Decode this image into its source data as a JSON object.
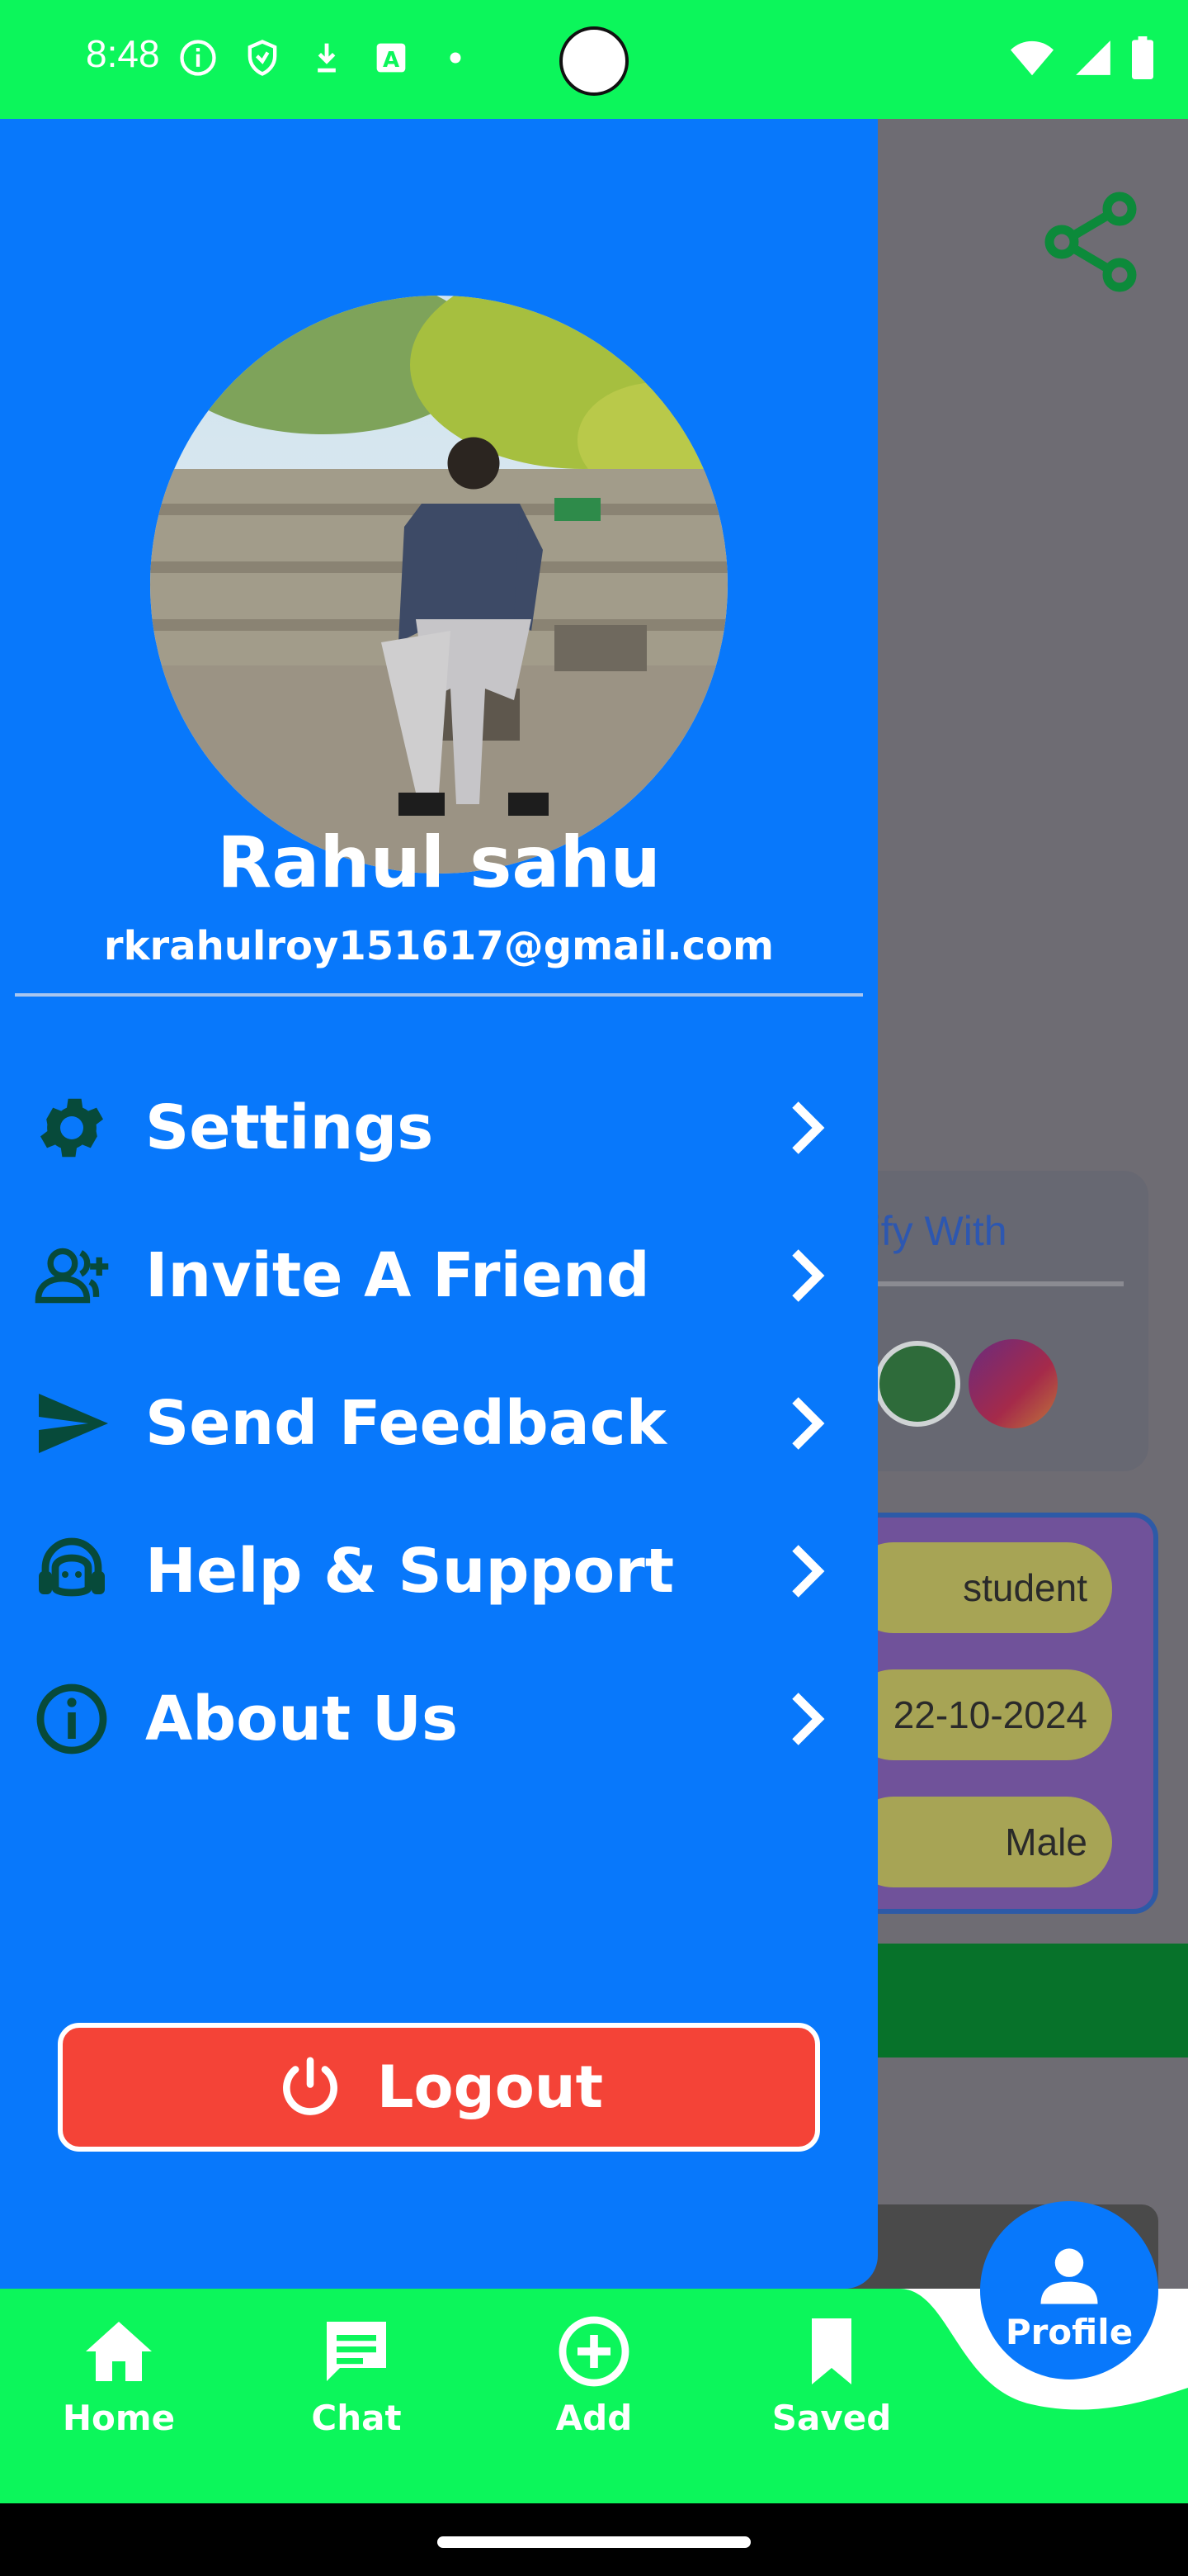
{
  "status_bar": {
    "time": "8:48",
    "left_icons": [
      "info-circle-icon",
      "shield-icon",
      "download-arrow-icon",
      "keyboard-a-icon",
      "dot-icon"
    ],
    "right_icons": [
      "wifi-icon",
      "signal-icon",
      "battery-icon"
    ]
  },
  "drawer": {
    "user_name": "Rahul sahu",
    "user_email": "rkrahulroy151617@gmail.com",
    "menu": [
      {
        "label": "Settings",
        "icon": "gear-icon"
      },
      {
        "label": "Invite A Friend",
        "icon": "add-user-icon"
      },
      {
        "label": "Send Feedback",
        "icon": "send-icon"
      },
      {
        "label": "Help & Support",
        "icon": "headset-icon"
      },
      {
        "label": "About Us",
        "icon": "info-icon"
      }
    ],
    "logout_label": "Logout"
  },
  "background": {
    "verify_text": "rify With",
    "info_values": [
      "student",
      "22-10-2024",
      "Male"
    ]
  },
  "bottom_nav": {
    "items": [
      {
        "label": "Home",
        "icon": "home-icon"
      },
      {
        "label": "Chat",
        "icon": "chat-icon"
      },
      {
        "label": "Add",
        "icon": "add-circle-icon"
      },
      {
        "label": "Saved",
        "icon": "bookmark-icon"
      }
    ],
    "profile_label": "Profile"
  },
  "colors": {
    "accent_green": "#0cf65b",
    "drawer_blue": "#0878fb",
    "logout_red": "#f44337",
    "icon_dark": "#074a3a"
  }
}
